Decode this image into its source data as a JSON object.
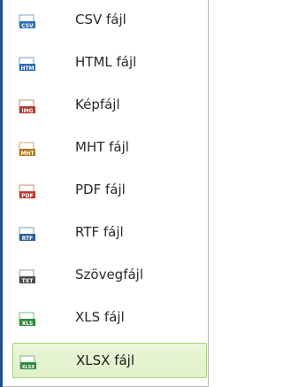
{
  "menu": {
    "items": [
      {
        "label": "CSV fájl",
        "icon": "csv-file-icon",
        "badge": "CSV",
        "color": "#2e6db4"
      },
      {
        "label": "HTML fájl",
        "icon": "html-file-icon",
        "badge": "HTM",
        "color": "#2e6db4"
      },
      {
        "label": "Képfájl",
        "icon": "image-file-icon",
        "badge": "IMG",
        "color": "#b23a2a"
      },
      {
        "label": "MHT fájl",
        "icon": "mht-file-icon",
        "badge": "MHT",
        "color": "#b07a1a"
      },
      {
        "label": "PDF fájl",
        "icon": "pdf-file-icon",
        "badge": "PDF",
        "color": "#c0392b"
      },
      {
        "label": "RTF fájl",
        "icon": "rtf-file-icon",
        "badge": "RTF",
        "color": "#2e5f9a"
      },
      {
        "label": "Szövegfájl",
        "icon": "text-file-icon",
        "badge": "TXT",
        "color": "#4a4a4a"
      },
      {
        "label": "XLS fájl",
        "icon": "xls-file-icon",
        "badge": "XLS",
        "color": "#2e8b3a"
      },
      {
        "label": "XLSX fájl",
        "icon": "xlsx-file-icon",
        "badge": "XLSX",
        "color": "#2e8b3a"
      }
    ],
    "selected_index": 8,
    "selection_color": "#dff0c9",
    "edge_color": "#1f4f8f"
  }
}
